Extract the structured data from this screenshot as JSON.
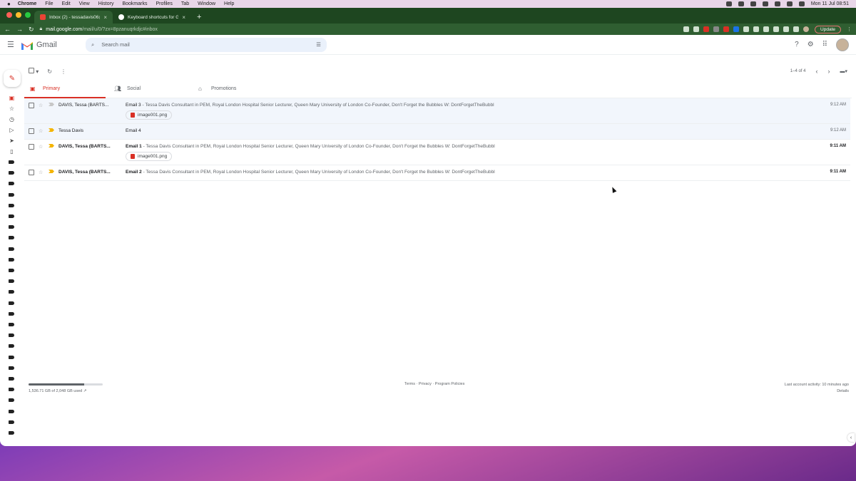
{
  "menubar": {
    "items": [
      "Chrome",
      "File",
      "Edit",
      "View",
      "History",
      "Bookmarks",
      "Profiles",
      "Tab",
      "Window",
      "Help"
    ],
    "clock": "Mon 11 Jul  08:51"
  },
  "browser": {
    "tabs": [
      {
        "title": "Inbox (2) - tessadavis06@gm..."
      },
      {
        "title": "Keyboard shortcuts for Gmail"
      }
    ],
    "url_host": "mail.google.com",
    "url_path": "/mail/u/0/?zx=8pzanuqrkdjc#inbox",
    "update_label": "Update"
  },
  "gmail": {
    "logo_text": "Gmail",
    "search_placeholder": "Search mail",
    "pager": "1–4 of 4",
    "categories": [
      {
        "label": "Primary",
        "icon": "inbox-icon"
      },
      {
        "label": "Social",
        "icon": "people-icon"
      },
      {
        "label": "Promotions",
        "icon": "tag-icon"
      }
    ],
    "emails": [
      {
        "sender": "DAVIS, Tessa (BARTS...",
        "subject": "Email 3",
        "snippet": " - Tessa Davis Consultant in PEM, Royal London Hospital Senior Lecturer, Queen Mary University of London Co-Founder, Don't Forget the Bubbles W: DontForgetTheBubbl",
        "time": "9:12 AM",
        "attachment": "image001.png"
      },
      {
        "sender": "Tessa Davis",
        "subject": "Email 4",
        "snippet": "",
        "time": "9:12 AM",
        "attachment": ""
      },
      {
        "sender": "DAVIS, Tessa (BARTS...",
        "subject": "Email 1",
        "snippet": " - Tessa Davis Consultant in PEM, Royal London Hospital Senior Lecturer, Queen Mary University of London Co-Founder, Don't Forget the Bubbles W: DontForgetTheBubbl",
        "time": "9:11 AM",
        "attachment": "image001.png"
      },
      {
        "sender": "DAVIS, Tessa (BARTS...",
        "subject": "Email 2",
        "snippet": " - Tessa Davis Consultant in PEM, Royal London Hospital Senior Lecturer, Queen Mary University of London Co-Founder, Don't Forget the Bubbles W: DontForgetTheBubbl",
        "time": "9:11 AM",
        "attachment": ""
      }
    ],
    "footer": {
      "storage": "1,536.71 GB of 2,048 GB used",
      "storage_fraction": 0.75,
      "links": "Terms · Privacy · Program Policies",
      "activity": "Last account activity: 10 minutes ago",
      "details": "Details"
    }
  },
  "colors": {
    "accent": "#d93025",
    "chrome_frame": "#1e4620",
    "important": "#f4b400"
  }
}
